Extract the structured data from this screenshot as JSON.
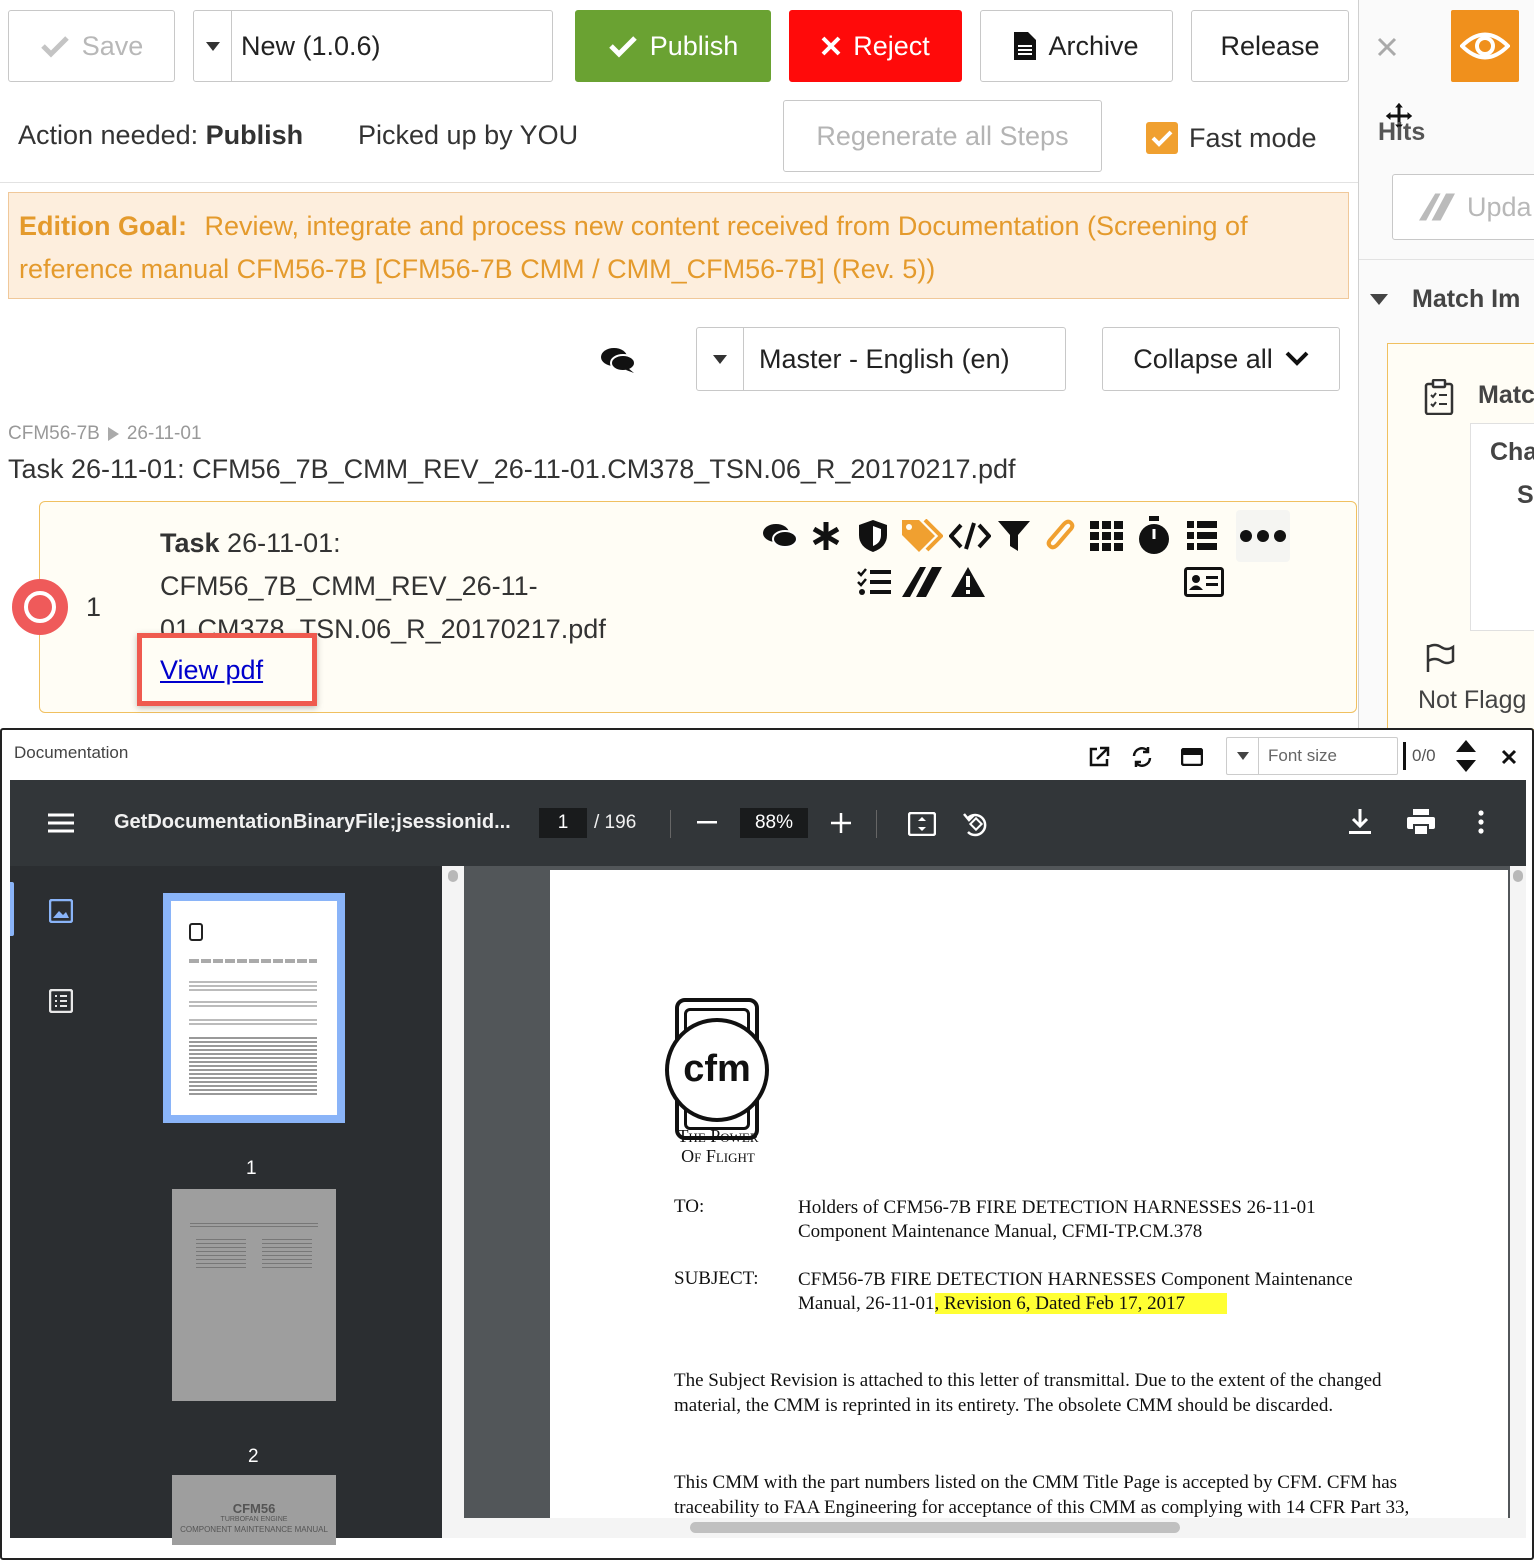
{
  "toolbar": {
    "save_label": "Save",
    "version_value": "New (1.0.6)",
    "publish_label": "Publish",
    "reject_label": "Reject",
    "archive_label": "Archive",
    "release_label": "Release"
  },
  "status": {
    "action_prefix": "Action needed:",
    "action_value": "Publish",
    "picked_up": "Picked up by YOU",
    "regenerate_label": "Regenerate all Steps",
    "fast_mode_label": "Fast mode"
  },
  "goal": {
    "label": "Edition Goal:",
    "text": "Review, integrate and process new content received from Documentation (Screening of reference manual CFM56-7B [CFM56-7B CMM / CMM_CFM56-7B] (Rev. 5))"
  },
  "controls": {
    "language_value": "Master - English (en)",
    "collapse_label": "Collapse all"
  },
  "breadcrumb": {
    "root": "CFM56-7B",
    "child": "26-11-01"
  },
  "task": {
    "heading": "Task 26-11-01: CFM56_7B_CMM_REV_26-11-01.CM378_TSN.06_R_20170217.pdf",
    "card_bold": "Task",
    "card_line1": " 26-11-01:",
    "card_line2": "CFM56_7B_CMM_REV_26-11-",
    "card_line3": "01.CM378_TSN.06_R_20170217.pdf",
    "row_number": "1",
    "view_pdf_label": "View pdf"
  },
  "right_panel": {
    "hits_label": "Hits",
    "update_label": "Upda",
    "match_section_label": "Match Im",
    "match_card_label": "Matc",
    "cha_label": "Cha",
    "s_label": "S",
    "not_flagged_label": "Not Flagg"
  },
  "doc_window": {
    "title": "Documentation",
    "font_size_placeholder": "Font size",
    "hit_counter": "0/0"
  },
  "pdf": {
    "filename": "GetDocumentationBinaryFile;jsessionid...",
    "current_page": "1",
    "total_pages": "/ 196",
    "zoom": "88%",
    "thumb1_label": "1",
    "thumb2_label": "2",
    "thumb3_title": "CFM56",
    "thumb3_sub": "TURBOFAN ENGINE",
    "thumb3_manual": "COMPONENT MAINTENANCE MANUAL"
  },
  "letter": {
    "logo_text": "cfm",
    "tagline1": "The Power",
    "tagline2": "Of Flight",
    "to_label": "TO:",
    "to_line1": "Holders of CFM56-7B FIRE DETECTION HARNESSES 26-11-01",
    "to_line2": "Component Maintenance Manual, CFMI-TP.CM.378",
    "subject_label": "SUBJECT:",
    "subject_line1": "CFM56-7B FIRE DETECTION HARNESSES Component Maintenance",
    "subject_line2_pre": "Manual, 26-11-01",
    "subject_line2_hl": ", Revision 6, Dated Feb 17, 2017",
    "para1_line1": "The Subject Revision is attached to this letter of transmittal. Due to the extent of the changed",
    "para1_line2": "material, the CMM is reprinted in its entirety. The obsolete CMM should be discarded.",
    "para2_line1": "This CMM with the part numbers listed on the CMM Title Page is accepted by CFM.  CFM has",
    "para2_line2": "traceability to FAA Engineering for acceptance of this CMM as complying with 14 CFR Part 33,"
  },
  "colors": {
    "publish": "#6aa232",
    "reject": "#ff0a0a",
    "accent_orange": "#f0a030",
    "goal_bg": "#fdeedd",
    "goal_text": "#e49a2c",
    "highlight": "#ffff33",
    "annotation_red": "#ef5a4f",
    "pdf_toolbar": "#323639",
    "pdf_sidebar": "#2b2e31"
  }
}
